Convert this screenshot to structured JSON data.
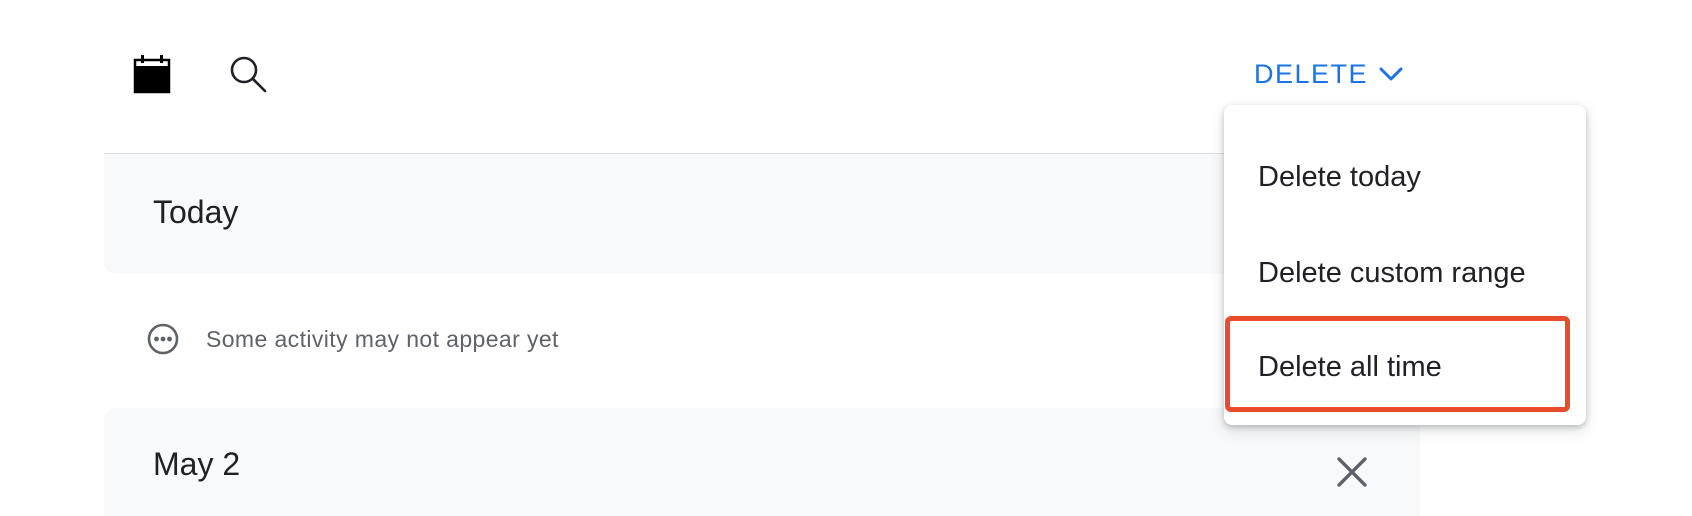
{
  "toolbar": {
    "calendar_icon": "calendar-icon",
    "search_icon": "search-icon",
    "delete_label": "DELETE",
    "delete_chevron_icon": "chevron-down-icon"
  },
  "sections": {
    "today": {
      "title": "Today"
    },
    "notice": {
      "text": "Some activity may not appear yet",
      "icon": "more-horiz-circle-icon"
    },
    "may2": {
      "title": "May 2",
      "close_icon": "close-icon"
    }
  },
  "menu": {
    "items": [
      {
        "label": "Delete today"
      },
      {
        "label": "Delete custom range"
      },
      {
        "label": "Delete all time"
      }
    ],
    "highlighted_index": 2
  },
  "colors": {
    "accent": "#1a73e8",
    "highlight": "#ea4b2c",
    "section_bg": "#f8f9fa",
    "divider": "#dadce0"
  }
}
